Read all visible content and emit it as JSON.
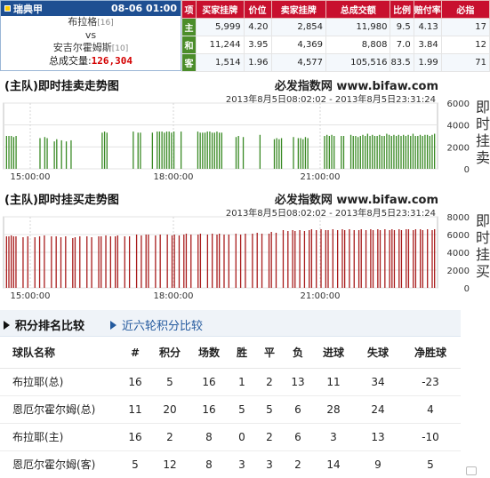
{
  "match": {
    "league": "瑞典甲",
    "datetime": "08-06 01:00",
    "home_team": "布拉格",
    "home_rank": "[16]",
    "vs": "vs",
    "away_team": "安吉尔霍姆斯",
    "away_rank": "[10]",
    "total_label": "总成交量:",
    "total_value": "126,304"
  },
  "odds_table": {
    "headers": [
      "项",
      "买家挂牌",
      "价位",
      "卖家挂牌",
      "总成交额",
      "比例",
      "赔付率",
      "必指"
    ],
    "rows": [
      {
        "side": "主",
        "buy": "5,999",
        "price": "4.20",
        "sell": "2,854",
        "turnover": "11,980",
        "ratio": "9.5",
        "payout": "4.13",
        "index": "17"
      },
      {
        "side": "和",
        "buy": "11,244",
        "price": "3.95",
        "sell": "4,369",
        "turnover": "8,808",
        "ratio": "7.0",
        "payout": "3.84",
        "index": "12"
      },
      {
        "side": "客",
        "buy": "1,514",
        "price": "1.96",
        "sell": "4,577",
        "turnover": "105,516",
        "ratio": "83.5",
        "payout": "1.99",
        "index": "71"
      }
    ]
  },
  "colors": {
    "header_blue": "#1e4f92",
    "header_red": "#c8102e",
    "side_green": "#4b8d2a",
    "sell_bars": "#3a8a25",
    "buy_bars": "#a81c1c",
    "total_red": "#d40000",
    "tab_blue": "#245a9e"
  },
  "chart_data": [
    {
      "type": "bar",
      "title": "(主队)即时挂卖走势图",
      "brand": "必发指数网 www.bifaw.com",
      "range": "2013年8月5日08:02:02 - 2013年8月5日23:31:24",
      "side_label": "即时挂卖",
      "x_ticks": [
        "15:00:00",
        "18:00:00",
        "21:00:00"
      ],
      "y_ticks": [
        0,
        2000,
        4000,
        6000
      ],
      "ylim": [
        0,
        6000
      ],
      "color": "#3a8a25",
      "values": [
        3000,
        3000,
        3000,
        2900,
        3000,
        0,
        0,
        0,
        0,
        0,
        0,
        0,
        0,
        0,
        2800,
        0,
        2900,
        2800,
        0,
        0,
        2500,
        2700,
        0,
        2600,
        0,
        2500,
        0,
        2600,
        0,
        0,
        0,
        0,
        0,
        0,
        0,
        0,
        0,
        0,
        0,
        0,
        3300,
        3400,
        3300,
        0,
        0,
        0,
        0,
        0,
        0,
        0,
        0,
        0,
        0,
        3400,
        0,
        3300,
        3300,
        0,
        0,
        0,
        0,
        3300,
        0,
        3400,
        3400,
        3400,
        3300,
        3400,
        3400,
        3300,
        3400,
        0,
        0,
        3400,
        0,
        0,
        0,
        0,
        0,
        0,
        3400,
        3300,
        3300,
        3300,
        3400,
        3400,
        3300,
        3300,
        3400,
        3300,
        3300,
        0,
        0,
        0,
        0,
        0,
        2900,
        3000,
        0,
        2900,
        0,
        0,
        0,
        0,
        0,
        0,
        3100,
        0,
        0,
        0,
        0,
        0,
        2700,
        2800,
        2700,
        2800,
        0,
        0,
        0,
        0,
        2900,
        0,
        2800,
        2800,
        2700,
        2900,
        2800,
        0,
        0,
        0,
        0,
        0,
        0,
        3000,
        3100,
        3000,
        3100,
        3000,
        0,
        0,
        3000,
        3000,
        0,
        0,
        3100,
        3000,
        3000,
        2900,
        3000,
        3100,
        3000,
        3200,
        3000,
        3100,
        3000,
        3000,
        3100,
        3000,
        3000,
        3200,
        3100,
        3000,
        3100,
        3000,
        3100,
        3000,
        3100,
        3000,
        3100,
        3000,
        3200,
        3000,
        3000,
        3100,
        3000,
        3100,
        3100,
        3000,
        3100,
        3200
      ]
    },
    {
      "type": "bar",
      "title": "(主队)即时挂买走势图",
      "brand": "必发指数网 www.bifaw.com",
      "range": "2013年8月5日08:02:02 - 2013年8月5日23:31:24",
      "side_label": "即时挂买",
      "x_ticks": [
        "15:00:00",
        "18:00:00",
        "21:00:00"
      ],
      "y_ticks": [
        0,
        2000,
        4000,
        6000,
        8000
      ],
      "ylim": [
        0,
        8000
      ],
      "color": "#a81c1c",
      "values": [
        5800,
        5800,
        5900,
        5800,
        5800,
        0,
        0,
        5700,
        0,
        5800,
        0,
        0,
        5700,
        0,
        5800,
        0,
        5900,
        0,
        0,
        5800,
        0,
        5800,
        0,
        5700,
        0,
        5800,
        0,
        0,
        5600,
        5700,
        0,
        5800,
        0,
        0,
        5800,
        0,
        5700,
        0,
        0,
        5800,
        5800,
        0,
        5900,
        0,
        5800,
        0,
        5800,
        5900,
        0,
        0,
        5800,
        0,
        5800,
        0,
        0,
        6000,
        0,
        5900,
        0,
        6000,
        6000,
        0,
        0,
        5900,
        0,
        6000,
        0,
        0,
        6000,
        0,
        5900,
        6000,
        0,
        5900,
        0,
        6000,
        6100,
        0,
        6000,
        0,
        0,
        6000,
        6100,
        0,
        0,
        6000,
        0,
        6100,
        0,
        6000,
        6100,
        0,
        6000,
        0,
        6000,
        0,
        0,
        6100,
        0,
        6000,
        0,
        6100,
        0,
        0,
        6100,
        0,
        6200,
        0,
        6100,
        0,
        0,
        6100,
        6300,
        0,
        6200,
        0,
        0,
        6500,
        0,
        6400,
        0,
        6500,
        6400,
        0,
        6500,
        0,
        6400,
        0,
        6500,
        6600,
        0,
        6500,
        0,
        6600,
        0,
        6500,
        6500,
        0,
        6600,
        0,
        6500,
        0,
        6600,
        6500,
        0,
        6600,
        0,
        6500,
        0,
        6500,
        6600,
        0,
        6500,
        0,
        6600,
        6500,
        0,
        6600,
        6500,
        0,
        6600,
        0,
        6500,
        6600,
        6500,
        0,
        6600,
        6500,
        0,
        6600,
        6600,
        0,
        6500,
        6600,
        0,
        6600,
        6500,
        0,
        6600,
        0,
        6500,
        6600
      ]
    }
  ],
  "rank_section": {
    "tab_active": "积分排名比较",
    "tab_other": "近六轮积分比较",
    "columns": [
      "球队名称",
      "#",
      "积分",
      "场数",
      "胜",
      "平",
      "负",
      "进球",
      "失球",
      "净胜球"
    ],
    "rows": [
      [
        "布拉耶(总)",
        "16",
        "5",
        "16",
        "1",
        "2",
        "13",
        "11",
        "34",
        "-23"
      ],
      [
        "恩厄尔霍尔姆(总)",
        "11",
        "20",
        "16",
        "5",
        "5",
        "6",
        "28",
        "24",
        "4"
      ],
      [
        "布拉耶(主)",
        "16",
        "2",
        "8",
        "0",
        "2",
        "6",
        "3",
        "13",
        "-10"
      ],
      [
        "恩厄尔霍尔姆(客)",
        "5",
        "12",
        "8",
        "3",
        "3",
        "2",
        "14",
        "9",
        "5"
      ]
    ]
  }
}
